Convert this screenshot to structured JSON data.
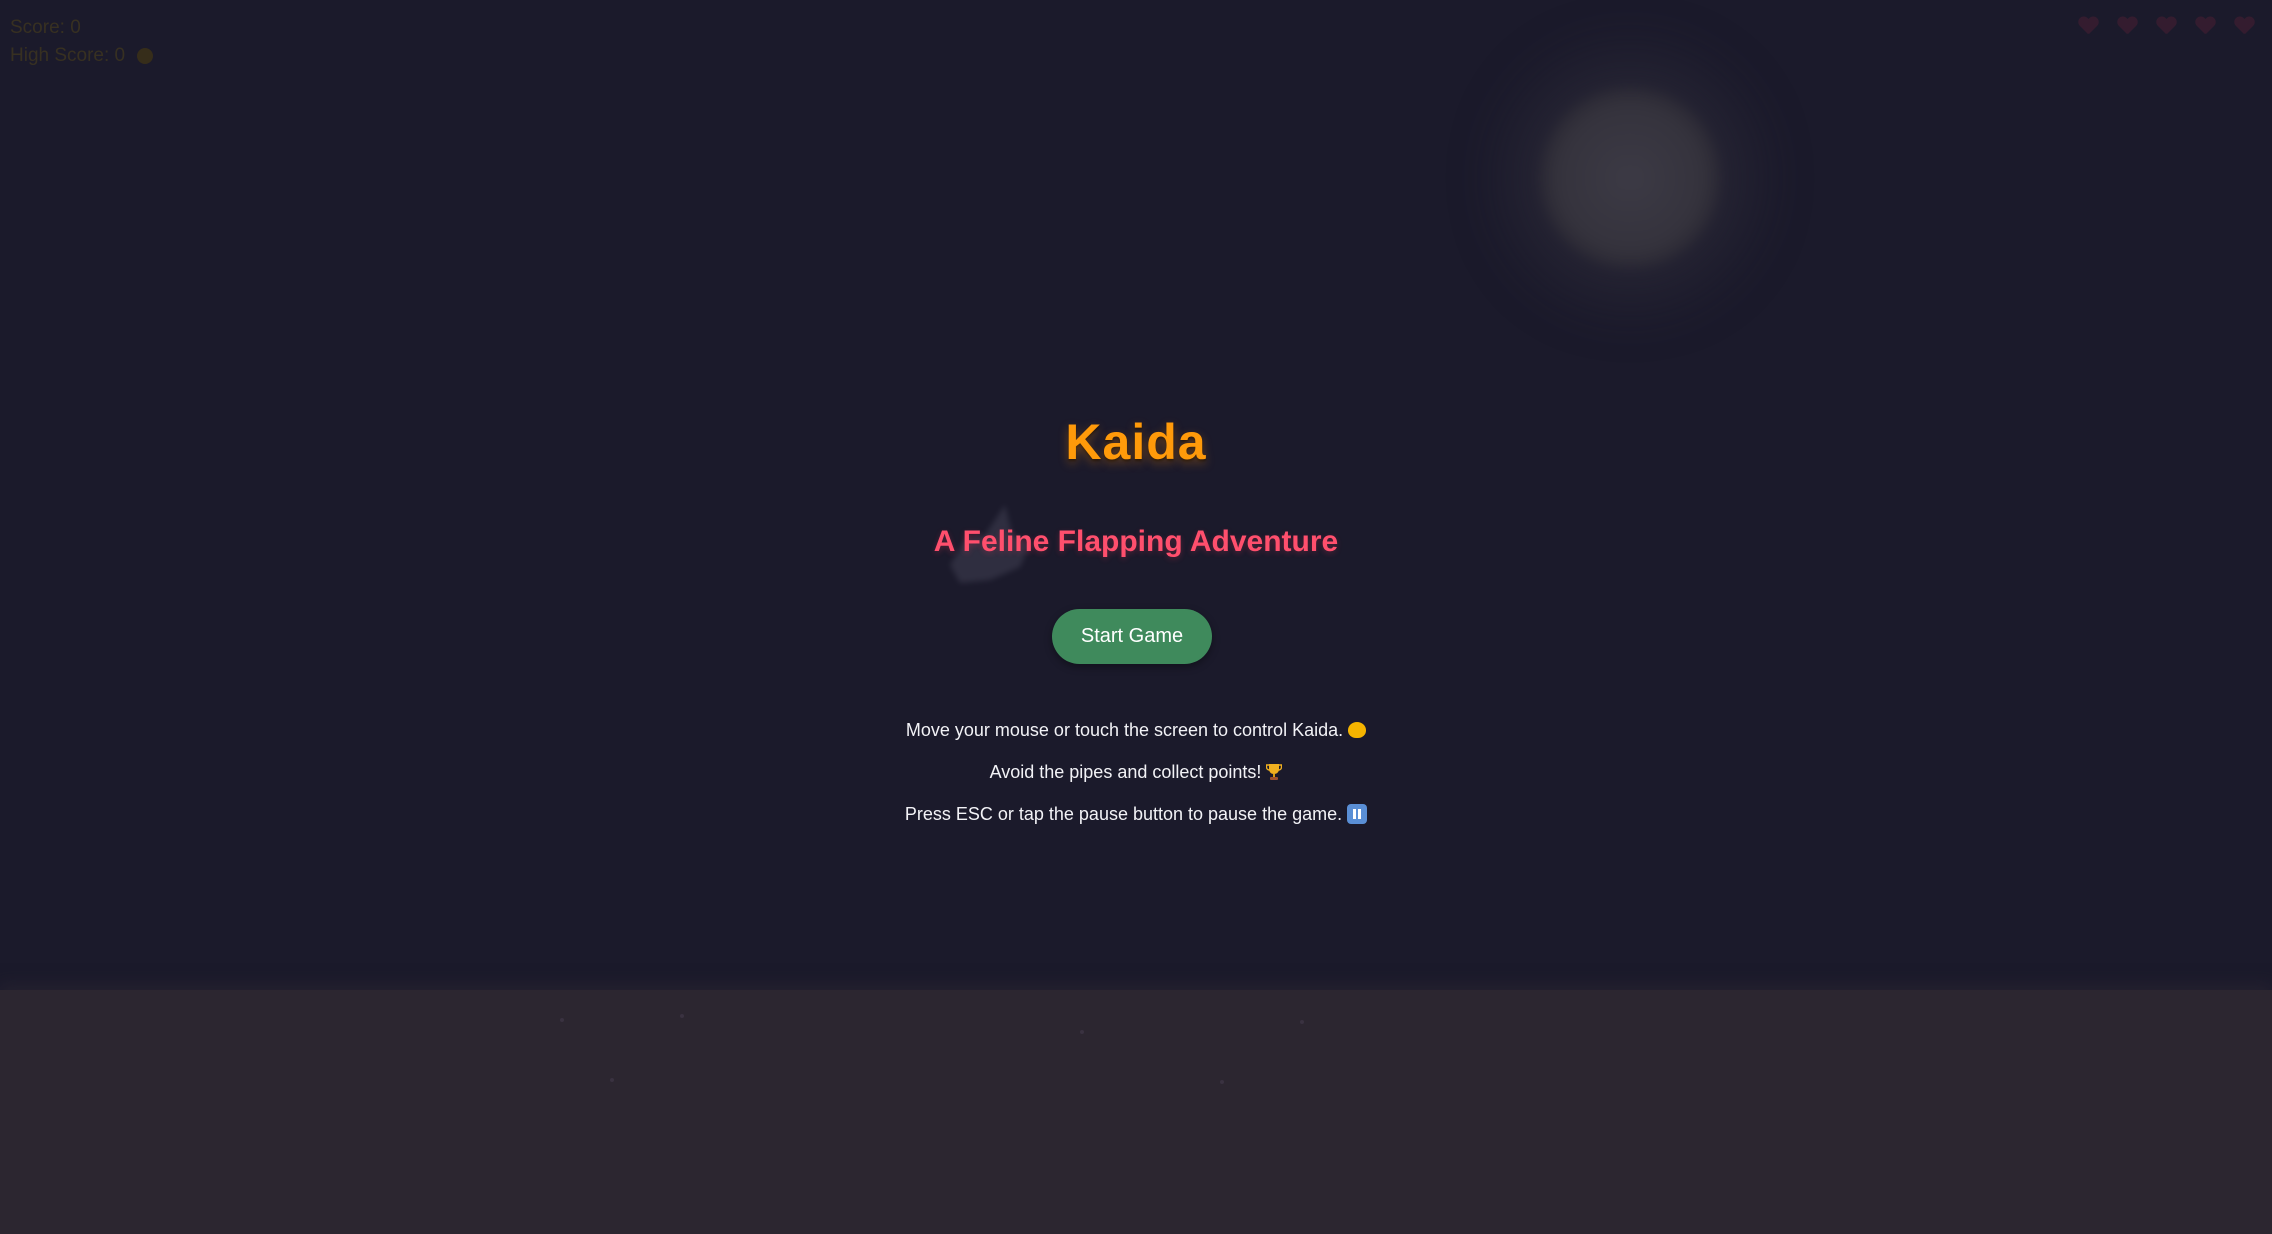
{
  "hud": {
    "score_label": "Score: 0",
    "high_score_label": "High Score: 0",
    "lives_count": 5,
    "lives_icon": "heart-icon"
  },
  "menu": {
    "title": "Kaida",
    "subtitle": "A Feline Flapping Adventure",
    "start_button_label": "Start Game",
    "instructions": [
      {
        "text": "Move your mouse or touch the screen to control Kaida.",
        "icon": "cat-face-icon"
      },
      {
        "text": "Avoid the pipes and collect points!",
        "icon": "trophy-icon"
      },
      {
        "text": "Press ESC or tap the pause button to pause the game.",
        "icon": "pause-icon"
      }
    ]
  },
  "colors": {
    "background": "#1b1a2b",
    "ground": "#2c2630",
    "title": "#ff9a0a",
    "subtitle": "#ff4f6d",
    "start_button": "#3f8a5c",
    "instruction_text": "#f2f2f6"
  }
}
